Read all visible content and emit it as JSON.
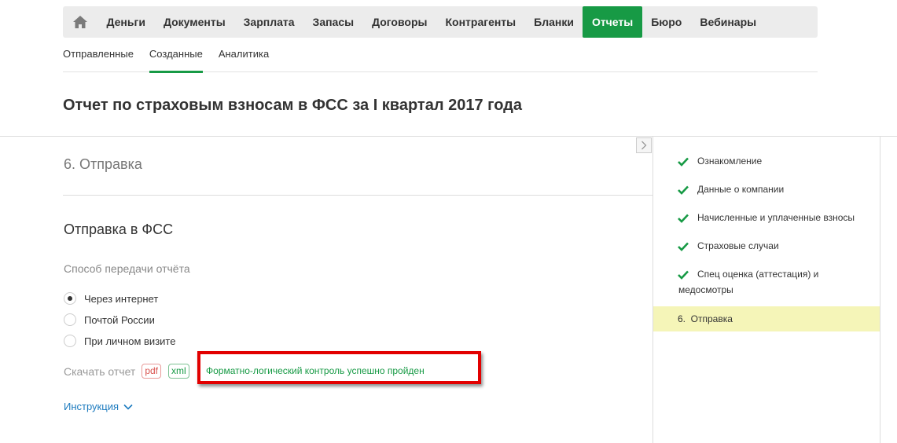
{
  "nav": {
    "items": [
      {
        "label": "Деньги",
        "active": false
      },
      {
        "label": "Документы",
        "active": false
      },
      {
        "label": "Зарплата",
        "active": false
      },
      {
        "label": "Запасы",
        "active": false
      },
      {
        "label": "Договоры",
        "active": false
      },
      {
        "label": "Контрагенты",
        "active": false
      },
      {
        "label": "Бланки",
        "active": false
      },
      {
        "label": "Отчеты",
        "active": true
      },
      {
        "label": "Бюро",
        "active": false
      },
      {
        "label": "Вебинары",
        "active": false
      }
    ]
  },
  "subnav": {
    "items": [
      {
        "label": "Отправленные",
        "active": false
      },
      {
        "label": "Созданные",
        "active": true
      },
      {
        "label": "Аналитика",
        "active": false
      }
    ]
  },
  "page": {
    "title": "Отчет по страховым взносам в ФСС за I квартал 2017 года"
  },
  "step": {
    "title": "6. Отправка",
    "section_title": "Отправка в ФСС",
    "method_label": "Способ передачи отчёта",
    "options": [
      {
        "label": "Через интернет",
        "selected": true
      },
      {
        "label": "Почтой России",
        "selected": false
      },
      {
        "label": "При личном визите",
        "selected": false
      }
    ],
    "download_label": "Скачать отчет",
    "pdf_label": "pdf",
    "xml_label": "xml",
    "flk_message": "Форматно-логический контроль успешно пройден",
    "instruction_label": "Инструкция"
  },
  "sidebar": {
    "items": [
      {
        "label": "Ознакомление",
        "done": true
      },
      {
        "label": "Данные о компании",
        "done": true
      },
      {
        "label": "Начисленные и уплаченные взносы",
        "done": true
      },
      {
        "label": "Страховые случаи",
        "done": true
      },
      {
        "label": "Спец оценка (аттестация) и",
        "label2": "медосмотры",
        "done": true
      },
      {
        "label": "6.  Отправка",
        "done": false,
        "active": true
      }
    ]
  },
  "colors": {
    "accent": "#179a45",
    "highlight_border": "#e20000",
    "active_step_bg": "#f5f5b8",
    "link": "#1d7bbf"
  }
}
